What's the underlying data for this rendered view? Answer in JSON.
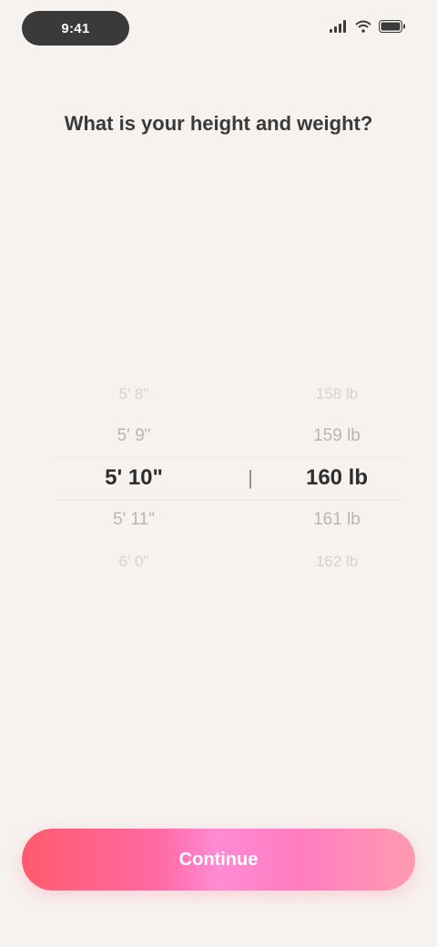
{
  "status_bar": {
    "time": "9:41",
    "icons": [
      "signal-icon",
      "wifi-icon",
      "battery-icon"
    ]
  },
  "question": "What is your height and weight?",
  "picker": {
    "height": {
      "items": [
        "5' 8\"",
        "5' 9\"",
        "5' 10\"",
        "5' 11\"",
        "6' 0\""
      ],
      "selected_index": 2
    },
    "separator": "|",
    "weight": {
      "items": [
        "158 lb",
        "159 lb",
        "160 lb",
        "161 lb",
        "162 lb"
      ],
      "selected_index": 2
    }
  },
  "continue_button": {
    "label": "Continue"
  },
  "colors": {
    "background": "#f6f2ef",
    "button_gradient_start": "#ff5b6e",
    "button_gradient_mid": "#ff8bd6",
    "button_gradient_end": "#ff9bb0"
  }
}
